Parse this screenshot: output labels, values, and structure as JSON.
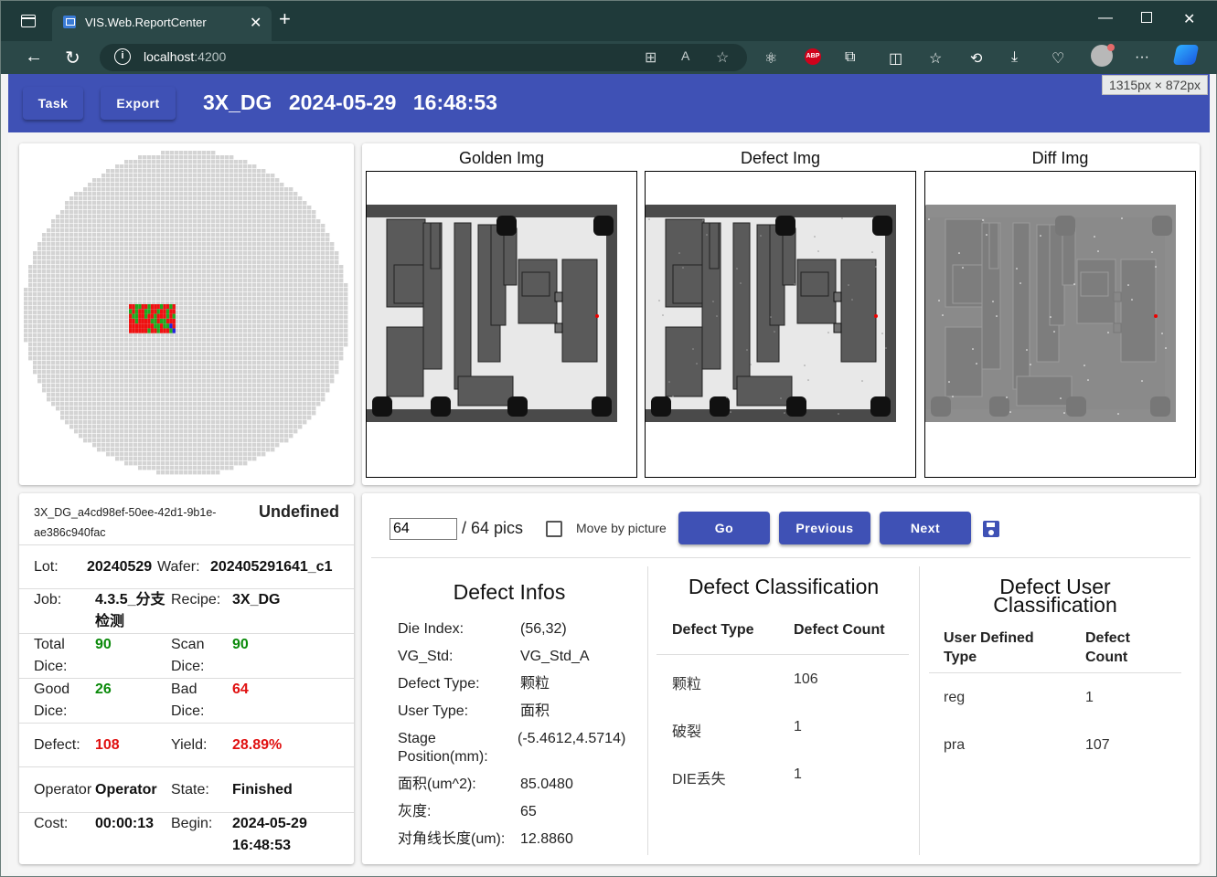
{
  "browser": {
    "tab_title": "VIS.Web.ReportCenter",
    "url_host": "localhost",
    "url_port": ":4200",
    "size_badge": "1315px × 872px",
    "icons": [
      "back-icon",
      "refresh-icon",
      "info-icon",
      "apps-icon",
      "read-aloud-icon",
      "favorite-star-icon",
      "react-devtools-icon",
      "adblock-icon",
      "extensions-icon",
      "split-screen-icon",
      "favorites-icon",
      "history-icon",
      "downloads-icon",
      "performance-icon",
      "profile-avatar",
      "more-icon",
      "copilot-icon"
    ]
  },
  "header": {
    "task_label": "Task",
    "export_label": "Export",
    "recipe": "3X_DG",
    "datetime": "2024-05-29 16:48:53"
  },
  "wafer_map": {
    "colors": {
      "die": "#d4d4d4",
      "good": "#1faa1f",
      "bad": "#ee1111",
      "other": "#2222dd"
    }
  },
  "images": {
    "golden_label": "Golden Img",
    "defect_label": "Defect Img",
    "diff_label": "Diff Img"
  },
  "info": {
    "id": "3X_DG_a4cd98ef-50ee-42d1-9b1e-ae386c940fac",
    "status": "Undefined",
    "lot_label": "Lot:",
    "lot": "20240529",
    "wafer_label": "Wafer:",
    "wafer": "202405291641_c1",
    "job_label": "Job:",
    "job": "4.3.5_分支检测",
    "recipe_label": "Recipe:",
    "recipe": "3X_DG",
    "total_dice_label": "Total Dice:",
    "total_dice": "90",
    "scan_dice_label": "Scan Dice:",
    "scan_dice": "90",
    "good_dice_label": "Good Dice:",
    "good_dice": "26",
    "bad_dice_label": "Bad Dice:",
    "bad_dice": "64",
    "defect_label": "Defect:",
    "defect": "108",
    "yield_label": "Yield:",
    "yield": "28.89%",
    "operator_label": "Operator",
    "operator": "Operator",
    "state_label": "State:",
    "state": "Finished",
    "cost_label": "Cost:",
    "cost": "00:00:13",
    "begin_label": "Begin:",
    "begin_date": "2024-05-29",
    "begin_time": "16:48:53"
  },
  "pager": {
    "current": "64",
    "total_text": "/ 64 pics",
    "move_by_picture_label": "Move by picture",
    "move_by_picture_checked": false,
    "go_label": "Go",
    "previous_label": "Previous",
    "next_label": "Next"
  },
  "defect_infos": {
    "title": "Defect Infos",
    "rows": [
      {
        "k": "Die Index:",
        "v": "(56,32)"
      },
      {
        "k": "VG_Std:",
        "v": "VG_Std_A"
      },
      {
        "k": "Defect Type:",
        "v": "颗粒"
      },
      {
        "k": "User Type:",
        "v": "面积"
      },
      {
        "k": "Stage",
        "k2": "Position(mm):",
        "v": "(-5.4612,4.5714)"
      },
      {
        "k": "面积(um^2):",
        "v": "85.0480"
      },
      {
        "k": "灰度:",
        "v": "65"
      },
      {
        "k": "对角线长度(um):",
        "v": "12.8860"
      }
    ]
  },
  "defect_classification": {
    "title": "Defect Classification",
    "col_type": "Defect Type",
    "col_count": "Defect Count",
    "rows": [
      {
        "type": "颗粒",
        "count": "106"
      },
      {
        "type": "破裂",
        "count": "1"
      },
      {
        "type": "DIE丢失",
        "count": "1"
      }
    ]
  },
  "user_classification": {
    "title_line1": "Defect User",
    "title_line2": "Classification",
    "col_type_line1": "User Defined",
    "col_type_line2": "Type",
    "col_count_line1": "Defect",
    "col_count_line2": "Count",
    "rows": [
      {
        "type": "reg",
        "count": "1"
      },
      {
        "type": "pra",
        "count": "107"
      }
    ]
  }
}
